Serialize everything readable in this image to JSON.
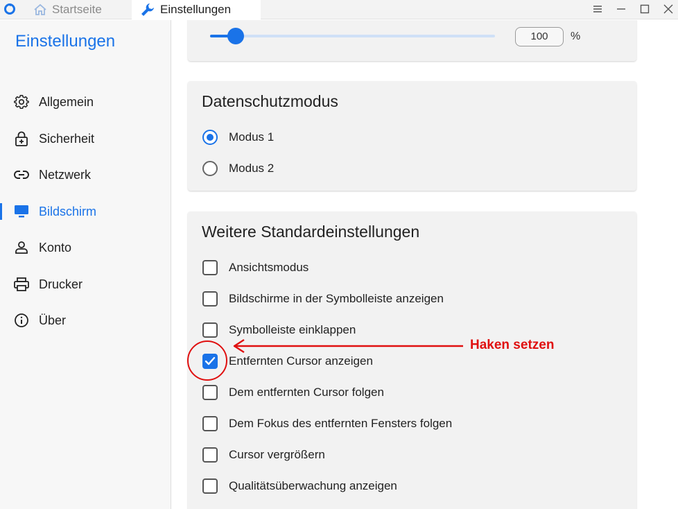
{
  "titlebar": {
    "tabs": [
      {
        "label": "Startseite",
        "icon": "home-icon"
      },
      {
        "label": "Einstellungen",
        "icon": "wrench-icon"
      }
    ],
    "controls": [
      "menu-icon",
      "minimize-icon",
      "maximize-icon",
      "close-icon"
    ]
  },
  "sidebar": {
    "title": "Einstellungen",
    "items": [
      {
        "label": "Allgemein",
        "icon": "gear-icon"
      },
      {
        "label": "Sicherheit",
        "icon": "lock-icon"
      },
      {
        "label": "Netzwerk",
        "icon": "link-icon"
      },
      {
        "label": "Bildschirm",
        "icon": "monitor-icon",
        "active": true
      },
      {
        "label": "Konto",
        "icon": "user-icon"
      },
      {
        "label": "Drucker",
        "icon": "printer-icon"
      },
      {
        "label": "Über",
        "icon": "info-icon"
      }
    ]
  },
  "slider_card": {
    "value": "100",
    "unit": "%",
    "slider_fraction": 0.09
  },
  "privacy": {
    "title": "Datenschutzmodus",
    "options": [
      {
        "label": "Modus 1",
        "selected": true
      },
      {
        "label": "Modus 2",
        "selected": false
      }
    ]
  },
  "more_defaults": {
    "title": "Weitere Standardeinstellungen",
    "options": [
      {
        "label": "Ansichtsmodus",
        "checked": false
      },
      {
        "label": "Bildschirme in der Symbolleiste anzeigen",
        "checked": false
      },
      {
        "label": "Symbolleiste einklappen",
        "checked": false
      },
      {
        "label": "Entfernten Cursor anzeigen",
        "checked": true
      },
      {
        "label": "Dem entfernten Cursor folgen",
        "checked": false
      },
      {
        "label": "Dem Fokus des entfernten Fensters folgen",
        "checked": false
      },
      {
        "label": "Cursor vergrößern",
        "checked": false
      },
      {
        "label": "Qualitätsüberwachung anzeigen",
        "checked": false
      }
    ]
  },
  "annotation": {
    "text": "Haken setzen"
  },
  "colors": {
    "accent": "#1a73e8",
    "annotation": "#e01010"
  }
}
